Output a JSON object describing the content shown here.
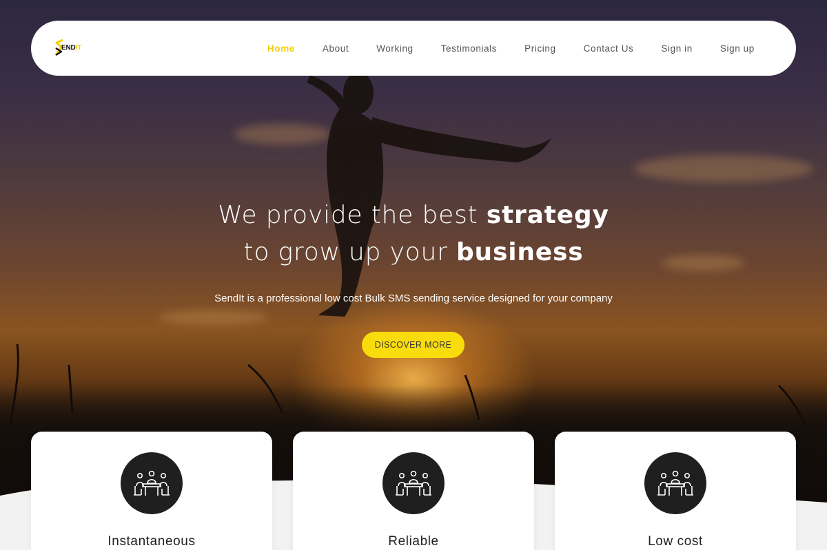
{
  "brand": {
    "logo_letter": "S",
    "logo_text_main": "END",
    "logo_text_accent": "IT",
    "accent_color": "#f9dc0c"
  },
  "nav": {
    "items": [
      {
        "label": "Home",
        "active": true
      },
      {
        "label": "About",
        "active": false
      },
      {
        "label": "Working",
        "active": false
      },
      {
        "label": "Testimonials",
        "active": false
      },
      {
        "label": "Pricing",
        "active": false
      },
      {
        "label": "Contact Us",
        "active": false
      },
      {
        "label": "Sign in",
        "active": false
      },
      {
        "label": "Sign up",
        "active": false
      }
    ]
  },
  "hero": {
    "line1_regular": "We provide the best ",
    "line1_bold": "strategy",
    "line2_regular": "to grow up your ",
    "line2_bold": "business",
    "subtitle": "SendIt is a professional low cost Bulk SMS sending service designed for your company",
    "cta_label": "DISCOVER MORE"
  },
  "features": [
    {
      "title": "Instantaneous",
      "icon": "meeting-icon"
    },
    {
      "title": "Reliable",
      "icon": "meeting-icon"
    },
    {
      "title": "Low cost",
      "icon": "meeting-icon"
    }
  ]
}
